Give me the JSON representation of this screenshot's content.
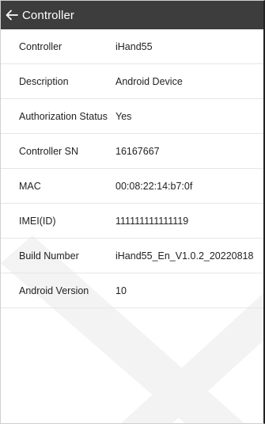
{
  "header": {
    "title": "Controller",
    "back_icon": "arrow-left-icon",
    "background_color": "#3d3d3d"
  },
  "rows": [
    {
      "label": "Controller",
      "value": "iHand55"
    },
    {
      "label": "Description",
      "value": "Android Device"
    },
    {
      "label": "Authorization Status",
      "value": "Yes"
    },
    {
      "label": "Controller SN",
      "value": "16167667"
    },
    {
      "label": "MAC",
      "value": "00:08:22:14:b7:0f"
    },
    {
      "label": "IMEI(ID)",
      "value": "111111111111119"
    },
    {
      "label": "Build Number",
      "value": "iHand55_En_V1.0.2_20220818"
    },
    {
      "label": "Android Version",
      "value": "10"
    }
  ]
}
